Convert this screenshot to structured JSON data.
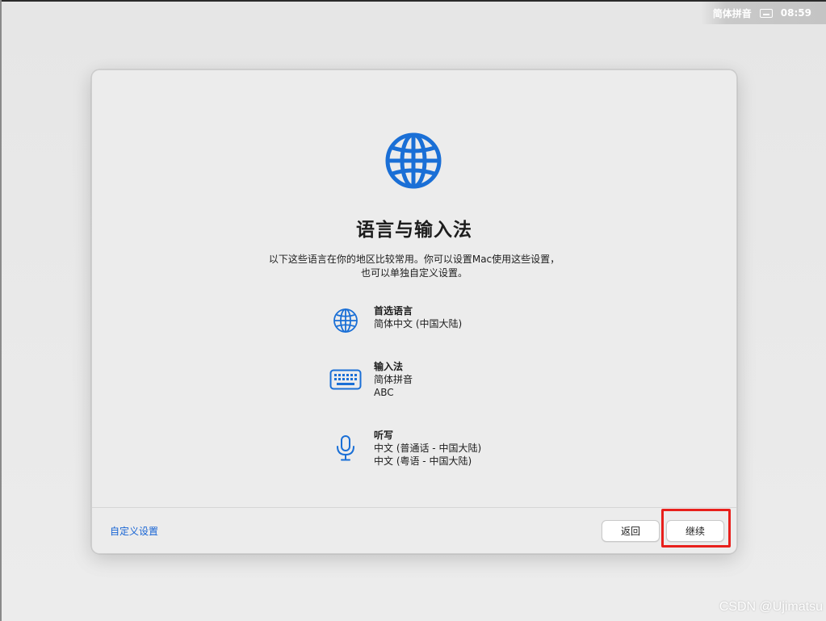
{
  "status_bar": {
    "input_method": "简体拼音",
    "keyboard_icon": "keyboard-icon",
    "time": "08:59"
  },
  "window": {
    "hero_icon": "globe-icon",
    "title": "语言与输入法",
    "subtitle_line1": "以下这些语言在你的地区比较常用。你可以设置Mac使用这些设置，",
    "subtitle_line2": "也可以单独自定义设置。",
    "settings": [
      {
        "icon": "globe-icon",
        "title": "首选语言",
        "lines": [
          "简体中文 (中国大陆)"
        ]
      },
      {
        "icon": "keyboard-icon",
        "title": "输入法",
        "lines": [
          "简体拼音",
          "ABC"
        ]
      },
      {
        "icon": "microphone-icon",
        "title": "听写",
        "lines": [
          "中文 (普通话 - 中国大陆)",
          "中文 (粤语 - 中国大陆)"
        ]
      }
    ],
    "footer": {
      "customize_link": "自定义设置",
      "back_button": "返回",
      "continue_button": "继续"
    }
  },
  "colors": {
    "accent_blue": "#1764d4",
    "icon_blue": "#1a6fd6",
    "highlight_red": "#e8201c"
  },
  "watermark": "CSDN @Ujimatsu"
}
